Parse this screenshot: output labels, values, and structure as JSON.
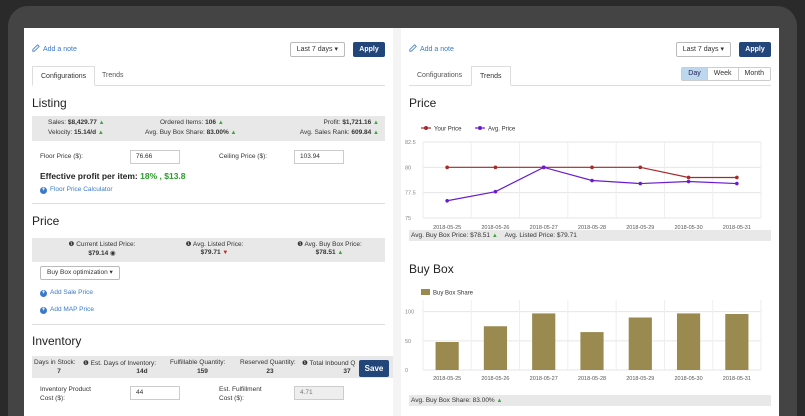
{
  "left": {
    "add_note": "Add a note",
    "range": "Last 7 days",
    "apply": "Apply",
    "tabs": [
      "Configurations",
      "Trends"
    ],
    "listing": {
      "title": "Listing",
      "sales_label": "Sales:",
      "sales_value": "$8,429.77",
      "ordered_label": "Ordered Items:",
      "ordered_value": "106",
      "profit_label": "Profit:",
      "profit_value": "$1,721.16",
      "velocity_label": "Velocity:",
      "velocity_value": "15.14/d",
      "bbshare_label": "Avg. Buy Box Share:",
      "bbshare_value": "83.00%",
      "rank_label": "Avg. Sales Rank:",
      "rank_value": "609.84",
      "floor_label": "Floor Price ($):",
      "floor_value": "76.66",
      "ceiling_label": "Ceiling Price ($):",
      "ceiling_value": "103.94",
      "effective_label": "Effective profit per item:",
      "effective_value": "18% , $13.8",
      "calc_link": "Floor Price Calculator"
    },
    "price": {
      "title": "Price",
      "current_label": "Current Listed Price:",
      "current_value": "$79.14",
      "avg_listed_label": "Avg. Listed Price:",
      "avg_listed_value": "$79.71",
      "avg_bb_label": "Avg. Buy Box Price:",
      "avg_bb_value": "$78.51",
      "strategy": "Buy Box optimization",
      "add_sale": "Add Sale Price",
      "add_map": "Add MAP Price"
    },
    "inventory": {
      "title": "Inventory",
      "days_label": "Days in Stock:",
      "days_value": "7",
      "est_days_label": "Est. Days of Inventory:",
      "est_days_value": "14d",
      "fulfillable_label": "Fulfillable Quantity:",
      "fulfillable_value": "159",
      "reserved_label": "Reserved Quantity:",
      "reserved_value": "23",
      "inbound_label": "Total Inbound Q",
      "inbound_value": "37",
      "save": "Save",
      "product_cost_label_1": "Inventory Product",
      "product_cost_label_2": "Cost ($):",
      "product_cost_value": "44",
      "fulfill_cost_label_1": "Est. Fulfillment",
      "fulfill_cost_label_2": "Cost ($):",
      "fulfill_cost_value": "4.71"
    }
  },
  "right": {
    "add_note": "Add a note",
    "range": "Last 7 days",
    "apply": "Apply",
    "tabs": [
      "Configurations",
      "Trends"
    ],
    "granularity": [
      "Day",
      "Week",
      "Month"
    ],
    "price_section": {
      "title": "Price",
      "footer_bb": "Avg. Buy Box Price: $78.51",
      "footer_listed": "Avg. Listed Price: $79.71"
    },
    "buybox_section": {
      "title": "Buy Box",
      "footer": "Avg. Buy Box Share: 83.00%"
    }
  },
  "chart_data": [
    {
      "type": "line",
      "title": "Price",
      "x": [
        "2018-05-25",
        "2018-05-26",
        "2018-05-27",
        "2018-05-28",
        "2018-05-29",
        "2018-05-30",
        "2018-05-31"
      ],
      "series": [
        {
          "name": "Your Price",
          "color": "#a52a2a",
          "values": [
            80,
            80,
            80,
            80,
            80,
            79,
            79
          ]
        },
        {
          "name": "Avg. Price",
          "color": "#6a1bd1",
          "values": [
            76.7,
            77.6,
            80,
            78.7,
            78.4,
            78.6,
            78.4
          ]
        }
      ],
      "ylim": [
        75,
        82.5
      ],
      "yticks": [
        75,
        77.5,
        80,
        82.5
      ],
      "legend": "top-left",
      "grid": true
    },
    {
      "type": "bar",
      "title": "Buy Box",
      "categories": [
        "2018-05-25",
        "2018-05-26",
        "2018-05-27",
        "2018-05-28",
        "2018-05-29",
        "2018-05-30",
        "2018-05-31"
      ],
      "series": [
        {
          "name": "Buy Box Share",
          "color": "#9a8a50",
          "values": [
            48,
            75,
            97,
            65,
            90,
            97,
            96
          ]
        }
      ],
      "ylim": [
        0,
        120
      ],
      "yticks": [
        0,
        50,
        100
      ],
      "legend": "top-left",
      "grid": true
    }
  ]
}
